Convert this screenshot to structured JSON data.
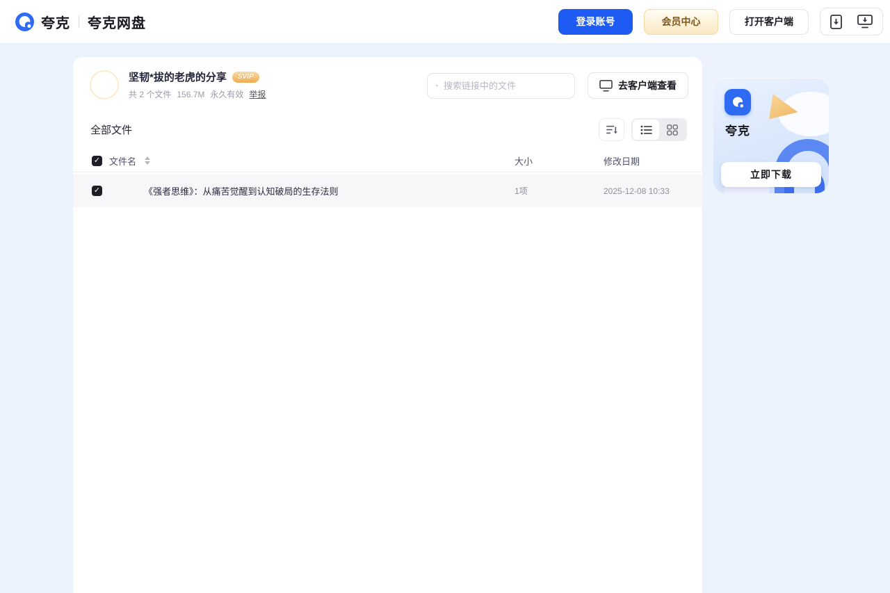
{
  "header": {
    "brand": "夸克",
    "product": "夸克网盘",
    "login_button": "登录账号",
    "member_button": "会员中心",
    "open_client_button": "打开客户端"
  },
  "share": {
    "title": "坚韧*拔的老虎的分享",
    "badge": "SVIP",
    "meta": {
      "count": "共 2 个文件",
      "size": "156.7M",
      "validity": "永久有效",
      "report": "举报"
    },
    "search_placeholder": "搜索链接中的文件",
    "view_in_client": "去客户端查看"
  },
  "files": {
    "section_title": "全部文件",
    "columns": {
      "name": "文件名",
      "size": "大小",
      "modified": "修改日期"
    },
    "rows": [
      {
        "name": "《强者思维》：从痛苦觉醒到认知破局的生存法则",
        "size": "1项",
        "modified": "2025-12-08 10:33"
      }
    ]
  },
  "promo": {
    "app_name": "夸克",
    "download_button": "立即下载"
  },
  "colors": {
    "accent_blue": "#1d5bf2",
    "member_gold_text": "#80551a",
    "svip_badge": "#eeab4e",
    "page_bg": "#edf3fd",
    "row_bg": "#f7f7f9"
  }
}
